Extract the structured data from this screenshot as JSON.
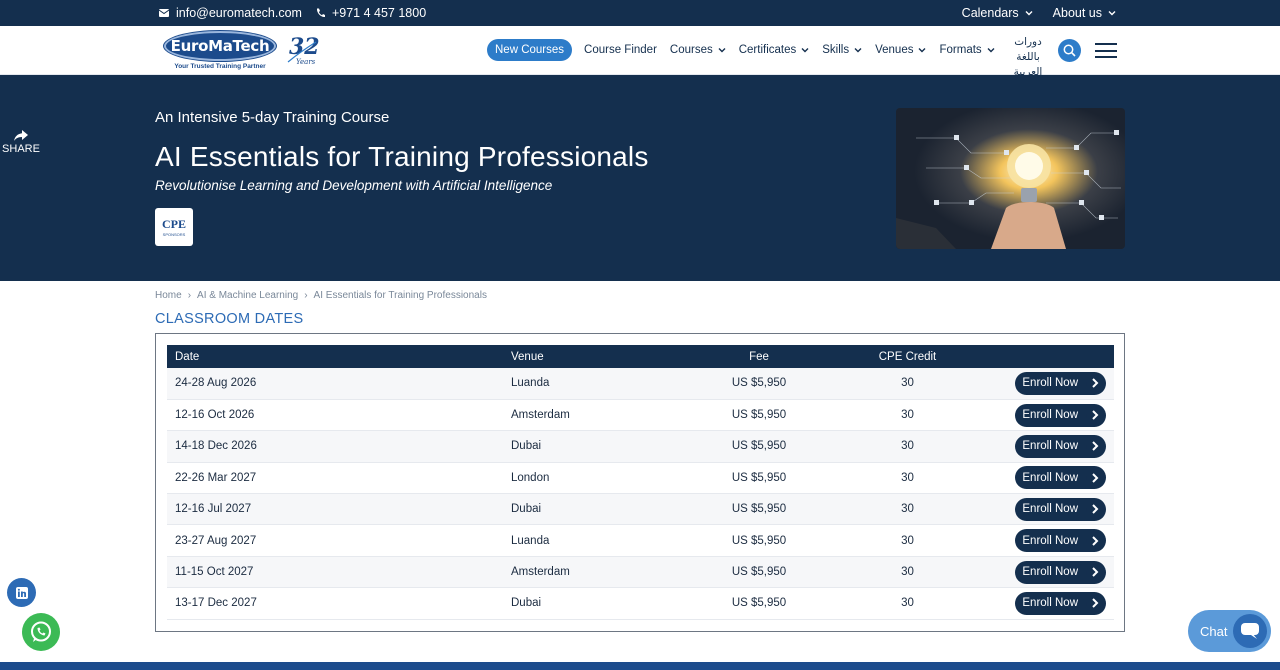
{
  "topbar": {
    "email": "info@euromatech.com",
    "phone": "+971 4 457 1800",
    "calendars": "Calendars",
    "about": "About us"
  },
  "header": {
    "logo_text": "EuroMaTech",
    "logo_tagline": "Your Trusted Training Partner",
    "years_badge": "32",
    "years_word": "Years",
    "nav": {
      "new_courses": "New Courses",
      "course_finder": "Course Finder",
      "courses": "Courses",
      "certificates": "Certificates",
      "skills": "Skills",
      "venues": "Venues",
      "formats": "Formats"
    },
    "arabic_line1": "دورات باللغة",
    "arabic_line2": "العربية"
  },
  "share_label": "SHARE",
  "hero": {
    "intro": "An Intensive 5-day Training Course",
    "title": "AI Essentials for Training Professionals",
    "subtitle": "Revolutionise Learning and Development with Artificial Intelligence",
    "badge": "CPE",
    "badge_small": "SPONSORS"
  },
  "breadcrumb": [
    "Home",
    "AI & Machine Learning",
    "AI Essentials for Training Professionals"
  ],
  "section_title": "CLASSROOM DATES",
  "table": {
    "headers": {
      "date": "Date",
      "venue": "Venue",
      "fee": "Fee",
      "cpe": "CPE Credit"
    },
    "enroll_label": "Enroll Now",
    "rows": [
      {
        "date": "24-28 Aug 2026",
        "venue": "Luanda",
        "fee": "US $5,950",
        "cpe": "30"
      },
      {
        "date": "12-16 Oct 2026",
        "venue": "Amsterdam",
        "fee": "US $5,950",
        "cpe": "30"
      },
      {
        "date": "14-18 Dec 2026",
        "venue": "Dubai",
        "fee": "US $5,950",
        "cpe": "30"
      },
      {
        "date": "22-26 Mar 2027",
        "venue": "London",
        "fee": "US $5,950",
        "cpe": "30"
      },
      {
        "date": "12-16 Jul 2027",
        "venue": "Dubai",
        "fee": "US $5,950",
        "cpe": "30"
      },
      {
        "date": "23-27 Aug 2027",
        "venue": "Luanda",
        "fee": "US $5,950",
        "cpe": "30"
      },
      {
        "date": "11-15 Oct 2027",
        "venue": "Amsterdam",
        "fee": "US $5,950",
        "cpe": "30"
      },
      {
        "date": "13-17 Dec 2027",
        "venue": "Dubai",
        "fee": "US $5,950",
        "cpe": "30"
      }
    ]
  },
  "chat_label": "Chat",
  "colors": {
    "navy": "#142f4e",
    "accent_blue": "#2d7cc9",
    "whatsapp_green": "#3cba55"
  }
}
